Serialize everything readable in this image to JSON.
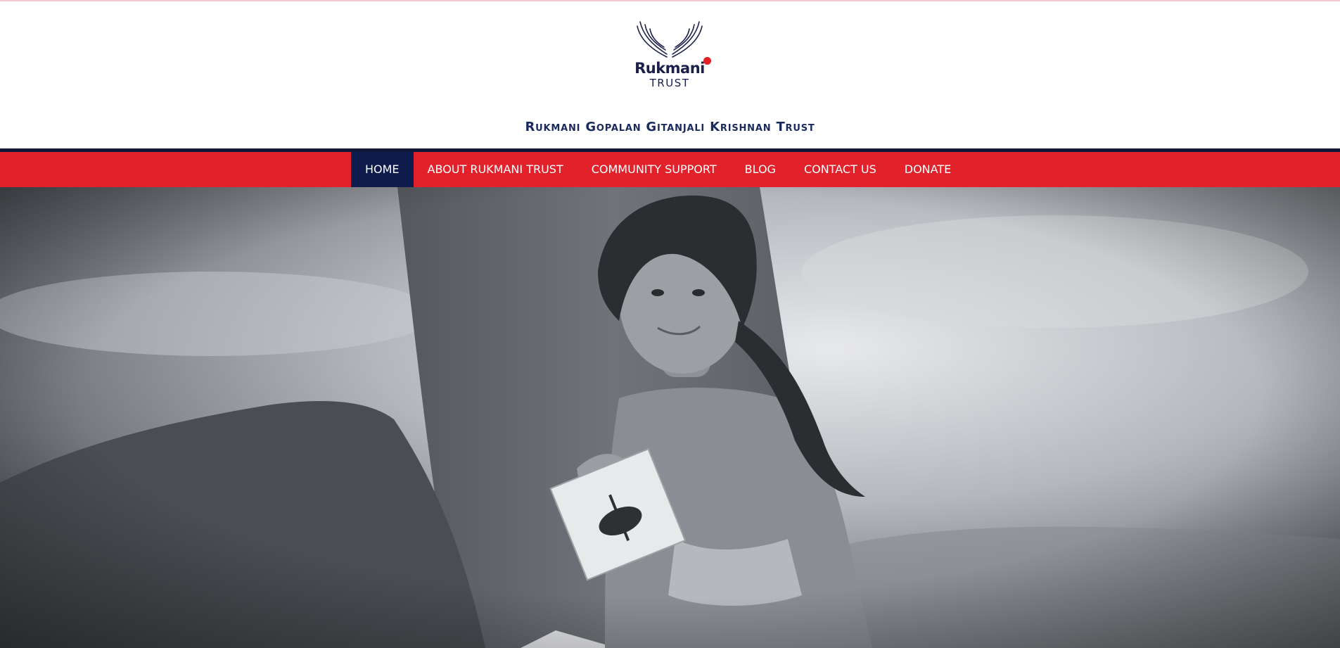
{
  "brand": {
    "logo_name": "Rukmani",
    "logo_sub": "TRUST",
    "tagline": "Rukmani Gopalan Gitanjali Krishnan Trust"
  },
  "nav": {
    "items": [
      {
        "label": "HOME",
        "active": true
      },
      {
        "label": "ABOUT RUKMANI TRUST",
        "active": false
      },
      {
        "label": "COMMUNITY SUPPORT",
        "active": false
      },
      {
        "label": "BLOG",
        "active": false
      },
      {
        "label": "CONTACT US",
        "active": false
      },
      {
        "label": "DONATE",
        "active": false
      }
    ]
  },
  "colors": {
    "nav_red": "#e3212b",
    "nav_active": "#0f1a4d",
    "brand_navy": "#1b2a5c",
    "logo_dot": "#e32028"
  }
}
